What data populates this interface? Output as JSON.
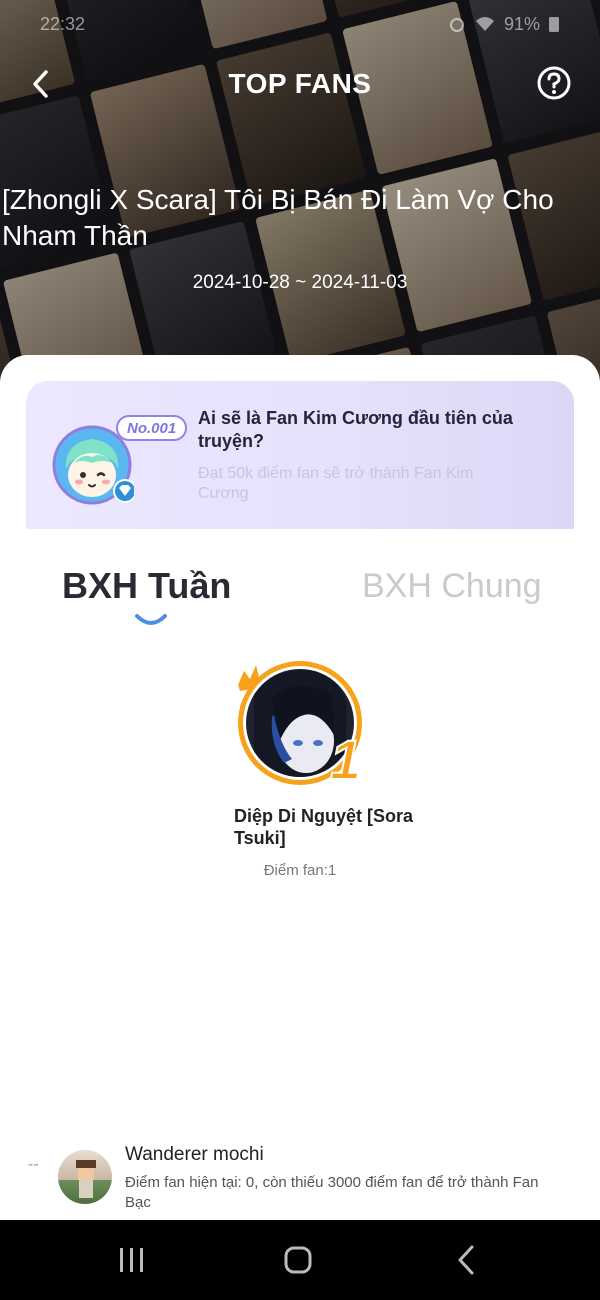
{
  "status_bar": {
    "time": "22:32",
    "battery": "91%"
  },
  "header": {
    "title": "TOP FANS"
  },
  "story": {
    "title": "[Zhongli X Scara] Tôi Bị Bán Đi Làm Vợ Cho Nham Thần",
    "date_range": "2024-10-28 ~ 2024-11-03"
  },
  "promo": {
    "badge": "No.001",
    "title": "Ai sẽ là Fan Kim Cương đầu tiên của truyện?",
    "subtitle": "Đạt 50k điểm fan sẽ trở thành Fan Kim Cương"
  },
  "tabs": [
    {
      "label": "BXH Tuần",
      "active": true
    },
    {
      "label": "BXH Chung",
      "active": false
    }
  ],
  "ranking": [
    {
      "rank": "1",
      "name": "Diệp Di Nguyệt [Sora Tsuki]",
      "score": "Điểm fan:1"
    }
  ],
  "me": {
    "rank": "--",
    "name": "Wanderer mochi",
    "description": "Điểm fan hiện tại: 0, còn thiếu 3000 điểm fan để trở thành Fan Bạc"
  },
  "colors": {
    "accent": "#f7a21b",
    "tab_indicator": "#4a90e2",
    "promo_badge": "#7d77e0",
    "diamond": "#2f8fd8"
  },
  "icons": [
    "back-arrow-icon",
    "help-icon",
    "diamond-icon",
    "crown-icon",
    "recents-icon",
    "home-icon",
    "nav-back-icon"
  ]
}
